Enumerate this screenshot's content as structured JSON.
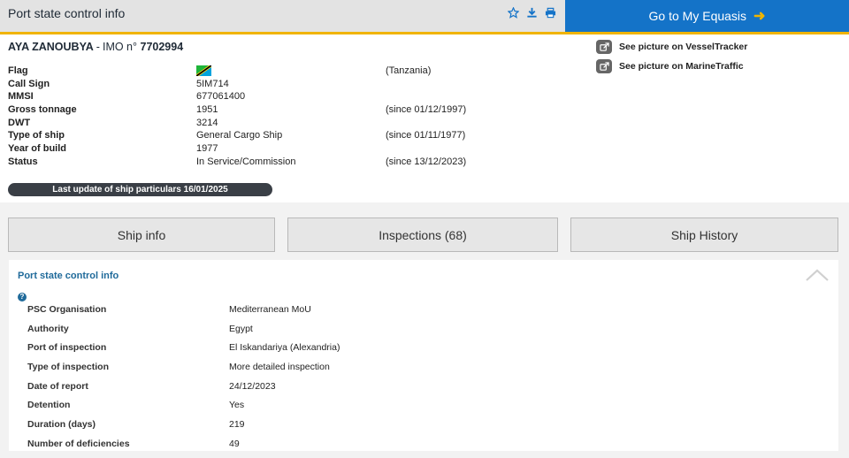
{
  "header": {
    "title": "Port state control info",
    "icons": [
      "star-icon",
      "download-icon",
      "print-icon"
    ],
    "goto_label": "Go to My Equasis",
    "accent_color": "#f0b400",
    "brand_color": "#1473c8"
  },
  "ship": {
    "name": "AYA ZANOUBYA",
    "separator": "-",
    "imo_label": "IMO n°",
    "imo": "7702994",
    "pictures": [
      {
        "label": "See picture on VesselTracker"
      },
      {
        "label": "See picture on MarineTraffic"
      }
    ],
    "details": [
      {
        "label": "Flag",
        "value": "",
        "since": "(Tanzania)"
      },
      {
        "label": "Call Sign",
        "value": "5IM714",
        "since": ""
      },
      {
        "label": "MMSI",
        "value": "677061400",
        "since": ""
      },
      {
        "label": "Gross tonnage",
        "value": "1951",
        "since": "(since 01/12/1997)"
      },
      {
        "label": "DWT",
        "value": "3214",
        "since": ""
      },
      {
        "label": "Type of ship",
        "value": "General Cargo Ship",
        "since": "(since 01/11/1977)"
      },
      {
        "label": "Year of build",
        "value": "1977",
        "since": ""
      },
      {
        "label": "Status",
        "value": "In Service/Commission",
        "since": "(since 13/12/2023)"
      }
    ],
    "last_update": "Last update of ship particulars 16/01/2025"
  },
  "tabs": [
    {
      "label": "Ship info"
    },
    {
      "label": "Inspections (68)"
    },
    {
      "label": "Ship History"
    }
  ],
  "psc": {
    "title": "Port state control info",
    "help_glyph": "?",
    "rows": [
      {
        "label": "PSC Organisation",
        "value": "Mediterranean MoU"
      },
      {
        "label": "Authority",
        "value": "Egypt"
      },
      {
        "label": "Port of inspection",
        "value": "El Iskandariya (Alexandria)"
      },
      {
        "label": "Type of inspection",
        "value": "More detailed inspection"
      },
      {
        "label": "Date of report",
        "value": "24/12/2023"
      },
      {
        "label": "Detention",
        "value": "Yes"
      },
      {
        "label": "Duration (days)",
        "value": "219"
      },
      {
        "label": "Number of deficiencies",
        "value": "49"
      }
    ]
  }
}
